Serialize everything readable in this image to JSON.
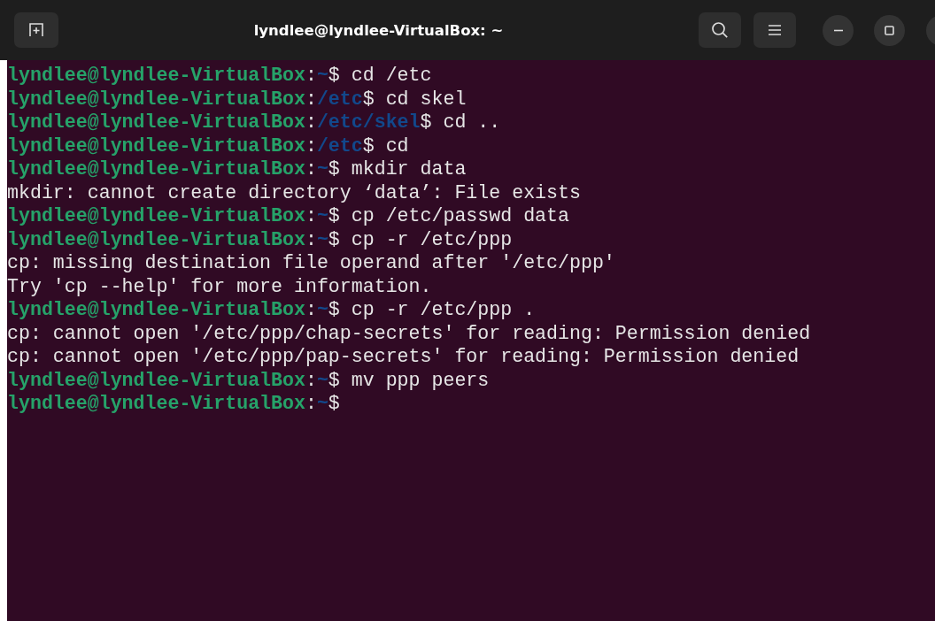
{
  "window": {
    "title": "lyndlee@lyndlee-VirtualBox: ~"
  },
  "terminal": {
    "lines": [
      {
        "kind": "prompt",
        "host": "lyndlee@lyndlee-VirtualBox",
        "sep": ":",
        "path": "~",
        "symbol": "$",
        "command": " cd /etc"
      },
      {
        "kind": "prompt",
        "host": "lyndlee@lyndlee-VirtualBox",
        "sep": ":",
        "path": "/etc",
        "symbol": "$",
        "command": " cd skel"
      },
      {
        "kind": "prompt",
        "host": "lyndlee@lyndlee-VirtualBox",
        "sep": ":",
        "path": "/etc/skel",
        "symbol": "$",
        "command": " cd .."
      },
      {
        "kind": "prompt",
        "host": "lyndlee@lyndlee-VirtualBox",
        "sep": ":",
        "path": "/etc",
        "symbol": "$",
        "command": " cd"
      },
      {
        "kind": "prompt",
        "host": "lyndlee@lyndlee-VirtualBox",
        "sep": ":",
        "path": "~",
        "symbol": "$",
        "command": " mkdir data"
      },
      {
        "kind": "output",
        "text": "mkdir: cannot create directory ‘data’: File exists"
      },
      {
        "kind": "prompt",
        "host": "lyndlee@lyndlee-VirtualBox",
        "sep": ":",
        "path": "~",
        "symbol": "$",
        "command": " cp /etc/passwd data"
      },
      {
        "kind": "prompt",
        "host": "lyndlee@lyndlee-VirtualBox",
        "sep": ":",
        "path": "~",
        "symbol": "$",
        "command": " cp -r /etc/ppp"
      },
      {
        "kind": "output",
        "text": "cp: missing destination file operand after '/etc/ppp'"
      },
      {
        "kind": "output",
        "text": "Try 'cp --help' for more information."
      },
      {
        "kind": "prompt",
        "host": "lyndlee@lyndlee-VirtualBox",
        "sep": ":",
        "path": "~",
        "symbol": "$",
        "command": " cp -r /etc/ppp ."
      },
      {
        "kind": "output",
        "text": "cp: cannot open '/etc/ppp/chap-secrets' for reading: Permission denied"
      },
      {
        "kind": "output",
        "text": "cp: cannot open '/etc/ppp/pap-secrets' for reading: Permission denied"
      },
      {
        "kind": "prompt",
        "host": "lyndlee@lyndlee-VirtualBox",
        "sep": ":",
        "path": "~",
        "symbol": "$",
        "command": " mv ppp peers"
      },
      {
        "kind": "prompt",
        "host": "lyndlee@lyndlee-VirtualBox",
        "sep": ":",
        "path": "~",
        "symbol": "$"
      }
    ]
  }
}
